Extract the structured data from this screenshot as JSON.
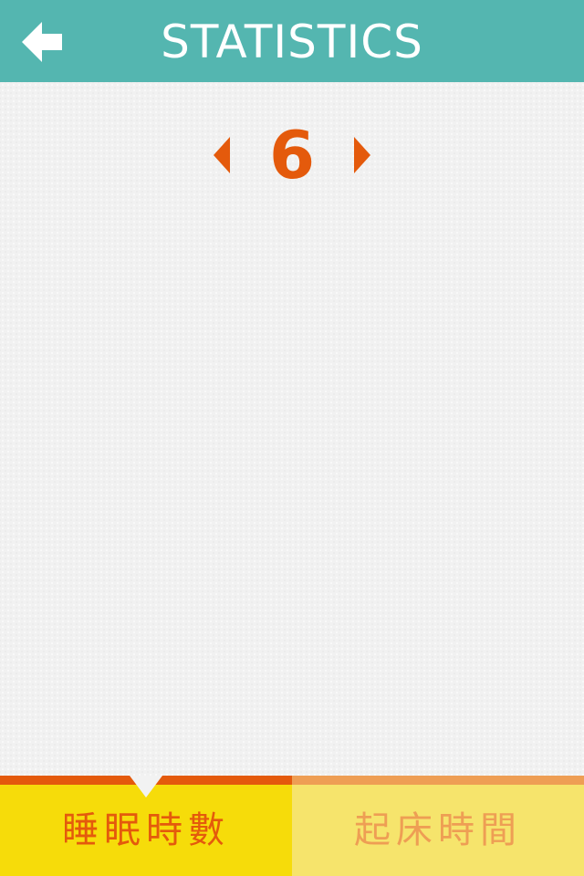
{
  "header": {
    "title": "STATISTICS",
    "back_icon": "arrow-left-icon",
    "background_color": "#54b6b0"
  },
  "selector": {
    "value": "6",
    "prev_icon": "triangle-left-icon",
    "next_icon": "triangle-right-icon",
    "accent_color": "#e45a0c"
  },
  "tabs": [
    {
      "label": "睡眠時數",
      "selected": true,
      "color": "#e45a0c",
      "background": "#f6dc0a"
    },
    {
      "label": "起床時間",
      "selected": false,
      "color": "#ee9e54",
      "background": "#f6e46c"
    }
  ]
}
